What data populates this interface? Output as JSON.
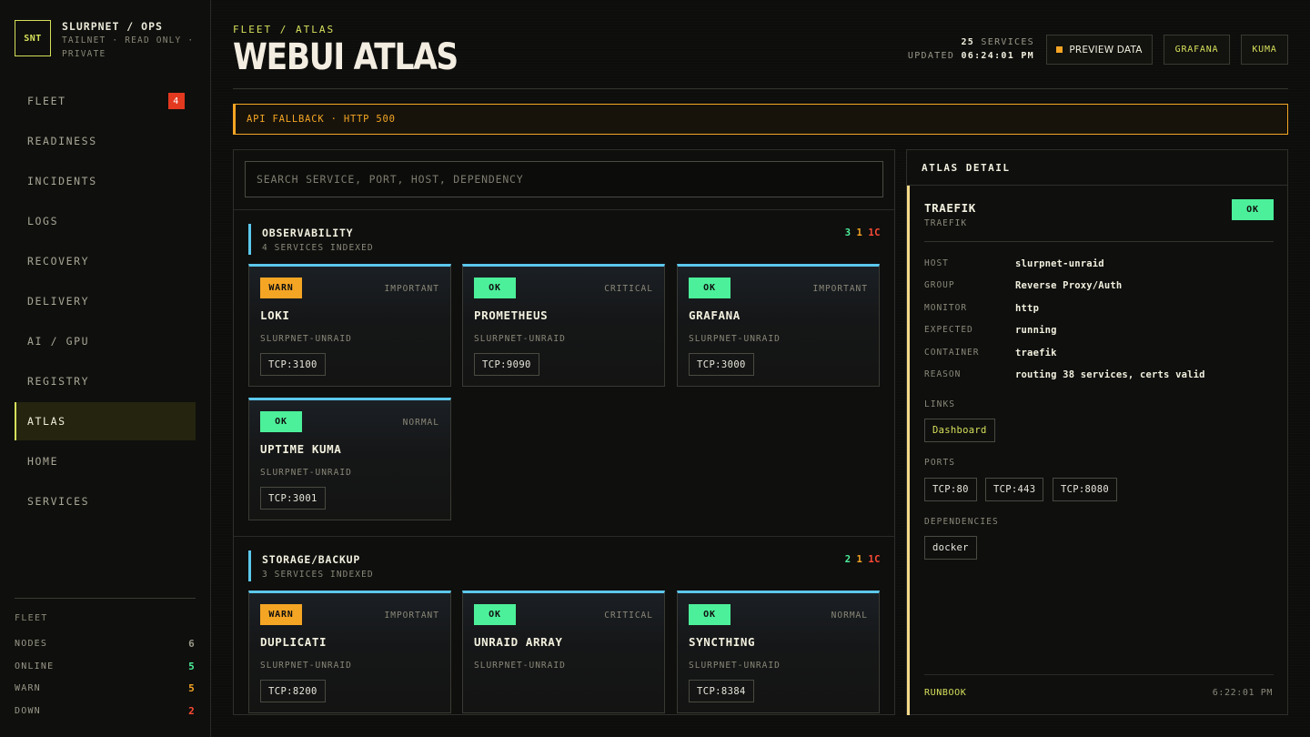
{
  "brand": {
    "logo": "SNT",
    "title": "SLURPNET / OPS",
    "subtitle": "TAILNET · READ ONLY · PRIVATE"
  },
  "nav": [
    {
      "label": "FLEET",
      "badge": "4"
    },
    {
      "label": "READINESS"
    },
    {
      "label": "INCIDENTS"
    },
    {
      "label": "LOGS"
    },
    {
      "label": "RECOVERY"
    },
    {
      "label": "DELIVERY"
    },
    {
      "label": "AI / GPU"
    },
    {
      "label": "REGISTRY"
    },
    {
      "label": "ATLAS",
      "active": true
    },
    {
      "label": "HOME"
    },
    {
      "label": "SERVICES"
    }
  ],
  "fleet_stats": {
    "title": "FLEET",
    "rows": [
      {
        "label": "NODES",
        "value": "6",
        "color": "#9a9888"
      },
      {
        "label": "ONLINE",
        "value": "5",
        "color": "#4cf09a"
      },
      {
        "label": "WARN",
        "value": "5",
        "color": "#f5a524"
      },
      {
        "label": "DOWN",
        "value": "2",
        "color": "#ff4a35"
      }
    ]
  },
  "header": {
    "breadcrumb": "FLEET / ATLAS",
    "title": "WEBUI ATLAS",
    "services_count": "25",
    "services_label": "SERVICES",
    "updated_label": "UPDATED",
    "updated_time": "06:24:01 PM",
    "preview_label": "PREVIEW DATA",
    "grafana_label": "GRAFANA",
    "kuma_label": "KUMA"
  },
  "alert": {
    "text": "API FALLBACK · HTTP 500"
  },
  "search": {
    "placeholder": "SEARCH SERVICE, PORT, HOST, DEPENDENCY"
  },
  "sections": [
    {
      "title": "OBSERVABILITY",
      "subtitle": "4 SERVICES INDEXED",
      "counts": {
        "ok": "3",
        "warn": "1",
        "down": "1C"
      },
      "cards": [
        {
          "status": "WARN",
          "priority": "IMPORTANT",
          "name": "LOKI",
          "host": "SLURPNET-UNRAID",
          "port": "TCP:3100"
        },
        {
          "status": "OK",
          "priority": "CRITICAL",
          "name": "PROMETHEUS",
          "host": "SLURPNET-UNRAID",
          "port": "TCP:9090"
        },
        {
          "status": "OK",
          "priority": "IMPORTANT",
          "name": "GRAFANA",
          "host": "SLURPNET-UNRAID",
          "port": "TCP:3000"
        },
        {
          "status": "OK",
          "priority": "NORMAL",
          "name": "UPTIME KUMA",
          "host": "SLURPNET-UNRAID",
          "port": "TCP:3001"
        }
      ]
    },
    {
      "title": "STORAGE/BACKUP",
      "subtitle": "3 SERVICES INDEXED",
      "counts": {
        "ok": "2",
        "warn": "1",
        "down": "1C"
      },
      "cards": [
        {
          "status": "WARN",
          "priority": "IMPORTANT",
          "name": "DUPLICATI",
          "host": "SLURPNET-UNRAID",
          "port": "TCP:8200"
        },
        {
          "status": "OK",
          "priority": "CRITICAL",
          "name": "UNRAID ARRAY",
          "host": "SLURPNET-UNRAID",
          "port": ""
        },
        {
          "status": "OK",
          "priority": "NORMAL",
          "name": "SYNCTHING",
          "host": "SLURPNET-UNRAID",
          "port": "TCP:8384"
        }
      ]
    }
  ],
  "detail": {
    "panel_title": "ATLAS DETAIL",
    "name": "TRAEFIK",
    "sub": "TRAEFIK",
    "status": "OK",
    "fields": [
      {
        "key": "HOST",
        "value": "slurpnet-unraid"
      },
      {
        "key": "GROUP",
        "value": "Reverse Proxy/Auth"
      },
      {
        "key": "MONITOR",
        "value": "http"
      },
      {
        "key": "EXPECTED",
        "value": "running"
      },
      {
        "key": "CONTAINER",
        "value": "traefik"
      },
      {
        "key": "REASON",
        "value": "routing 38 services, certs valid"
      }
    ],
    "links_label": "LINKS",
    "links": [
      "Dashboard"
    ],
    "ports_label": "PORTS",
    "ports": [
      "TCP:80",
      "TCP:443",
      "TCP:8080"
    ],
    "deps_label": "DEPENDENCIES",
    "deps": [
      "docker"
    ],
    "runbook_label": "RUNBOOK",
    "time": "6:22:01 PM"
  },
  "colors": {
    "accent": "#d6e05a",
    "ok": "#4cf09a",
    "warn": "#f5a524",
    "down": "#ff4a35",
    "section_bar": "#5cc8ec"
  }
}
